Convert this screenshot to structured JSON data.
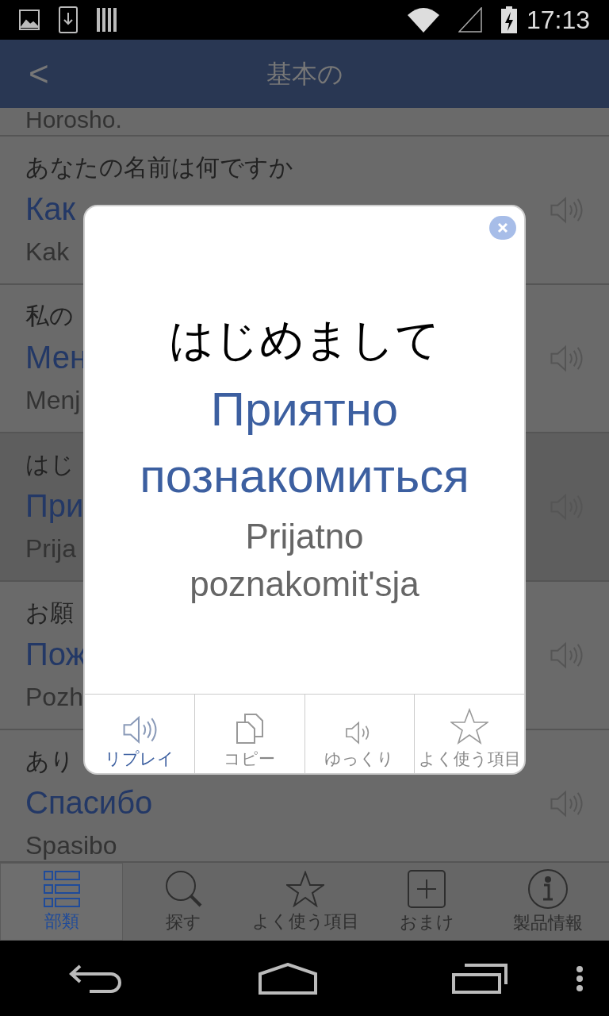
{
  "status_bar": {
    "time": "17:13"
  },
  "app_bar": {
    "back": "<",
    "title": "基本の"
  },
  "list": {
    "top_fragment": "Horosho.",
    "rows": [
      {
        "japanese": "あなたの名前は何ですか",
        "russian": "Как",
        "transliteration": "Kak",
        "selected": false
      },
      {
        "japanese": "私の",
        "russian": "Мен",
        "transliteration": "Menj",
        "selected": false
      },
      {
        "japanese": "はじ",
        "russian": "При",
        "transliteration": "Prija",
        "selected": true
      },
      {
        "japanese": "お願",
        "russian": "Пож",
        "transliteration": "Pozh",
        "selected": false
      },
      {
        "japanese": "あり",
        "russian": "Спасибо",
        "transliteration": "Spasibo",
        "selected": false
      }
    ]
  },
  "dialog": {
    "japanese": "はじめまして",
    "russian": "Приятно познакомиться",
    "transliteration": "Prijatno poznakomit'sja",
    "actions": [
      {
        "kind": "speaker",
        "label": "リプレイ",
        "selected": true
      },
      {
        "kind": "copy",
        "label": "コピー",
        "selected": false
      },
      {
        "kind": "slow",
        "label": "ゆっくり",
        "selected": false
      },
      {
        "kind": "star",
        "label": "よく使う項目",
        "selected": false
      }
    ]
  },
  "tabs": [
    {
      "kind": "categories",
      "label": "部類",
      "selected": true
    },
    {
      "kind": "search",
      "label": "探す",
      "selected": false
    },
    {
      "kind": "star",
      "label": "よく使う項目",
      "selected": false
    },
    {
      "kind": "extras",
      "label": "おまけ",
      "selected": false
    },
    {
      "kind": "info",
      "label": "製品情報",
      "selected": false
    }
  ]
}
